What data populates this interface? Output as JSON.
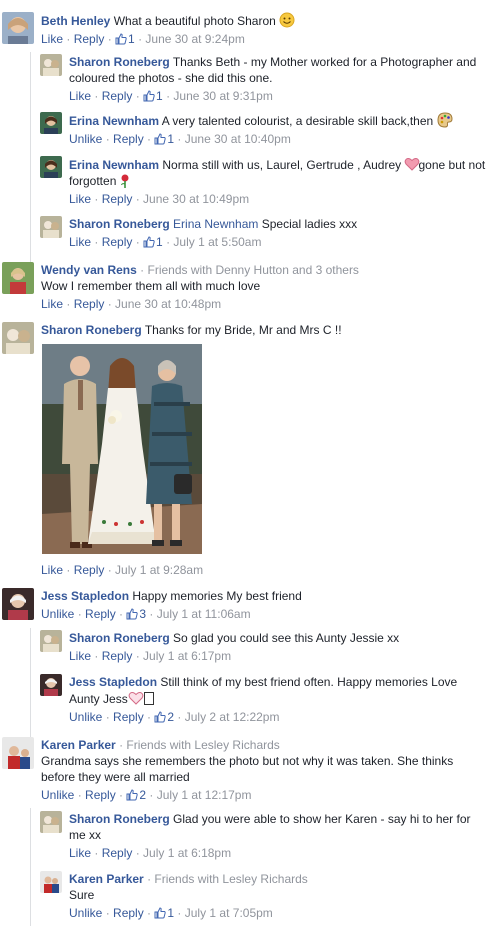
{
  "comments": [
    {
      "name": "Beth Henley",
      "text": "What a beautiful photo Sharon",
      "like": "Like",
      "reply": "Reply",
      "likes": "1",
      "time": "June 30 at 9:24pm"
    },
    {
      "name": "Sharon Roneberg",
      "text": "Thanks Beth - my Mother worked for a Photographer and coloured the photos - she did this one.",
      "like": "Like",
      "reply": "Reply",
      "likes": "1",
      "time": "June 30 at 9:31pm"
    },
    {
      "name": "Erina Newnham",
      "text": "A very talented colourist, a desirable skill back,then",
      "like": "Unlike",
      "reply": "Reply",
      "likes": "1",
      "time": "June 30 at 10:40pm"
    },
    {
      "name": "Erina Newnham",
      "text": "Norma still with us, Laurel, Gertrude , Audrey",
      "text2": "gone but not forgotten",
      "like": "Like",
      "reply": "Reply",
      "time": "June 30 at 10:49pm"
    },
    {
      "name": "Sharon Roneberg",
      "mention": "Erina Newnham",
      "text": "Special ladies xxx",
      "like": "Like",
      "reply": "Reply",
      "likes": "1",
      "time": "July 1 at 5:50am"
    },
    {
      "name": "Wendy van Rens",
      "friends": "· Friends with Denny Hutton and 3 others",
      "text": "Wow I remember them all with much love",
      "like": "Like",
      "reply": "Reply",
      "time": "June 30 at 10:48pm"
    },
    {
      "name": "Sharon Roneberg",
      "text": "Thanks for my Bride, Mr and Mrs C !!",
      "like": "Like",
      "reply": "Reply",
      "time": "July 1 at 9:28am"
    },
    {
      "name": "Jess Stapledon",
      "text": "Happy memories My best friend",
      "like": "Unlike",
      "reply": "Reply",
      "likes": "3",
      "time": "July 1 at 11:06am"
    },
    {
      "name": "Sharon Roneberg",
      "text": "So glad you could see this Aunty Jessie xx",
      "like": "Like",
      "reply": "Reply",
      "time": "July 1 at 6:17pm"
    },
    {
      "name": "Jess Stapledon",
      "text": "Still think of my best friend often. Happy memories Love Aunty Jess",
      "like": "Unlike",
      "reply": "Reply",
      "likes": "2",
      "time": "July 2 at 12:22pm"
    },
    {
      "name": "Karen Parker",
      "friends": "· Friends with Lesley Richards",
      "text": "Grandma says she remembers the photo but not why it was taken. She thinks before they were all married",
      "like": "Unlike",
      "reply": "Reply",
      "likes": "2",
      "time": "July 1 at 12:17pm"
    },
    {
      "name": "Sharon Roneberg",
      "text": "Glad you were able to show her Karen - say hi to her for me xx",
      "like": "Like",
      "reply": "Reply",
      "time": "July 1 at 6:18pm"
    },
    {
      "name": "Karen Parker",
      "friends": "· Friends with Lesley Richards",
      "text": "Sure",
      "like": "Unlike",
      "reply": "Reply",
      "likes": "1",
      "time": "July 1 at 7:05pm"
    }
  ],
  "colors": {
    "link": "#365899",
    "meta": "#90949c",
    "text": "#1d2129",
    "line": "#dddfe2"
  },
  "icons": [
    "thumbs-up-icon",
    "smiley-icon",
    "palette-icon",
    "heart-icon",
    "rose-icon"
  ]
}
